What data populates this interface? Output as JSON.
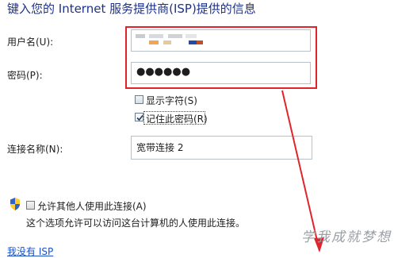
{
  "heading": "键入您的 Internet 服务提供商(ISP)提供的信息",
  "username": {
    "label": "用户名(U):"
  },
  "password": {
    "label": "密码(P):",
    "value": "●●●●●●"
  },
  "show_chars": {
    "label": "显示字符(S)",
    "checked": false
  },
  "remember_password": {
    "label": "记住此密码(R)",
    "checked": true
  },
  "connection_name": {
    "label": "连接名称(N):",
    "value": "宽带连接 2"
  },
  "allow_others": {
    "label": "允许其他人使用此连接(A)",
    "description": "这个选项允许可以访问这台计算机的人使用此连接。",
    "checked": false
  },
  "no_isp_link": "我没有 ISP",
  "watermark": "学我成就梦想",
  "colors": {
    "heading": "#1e3287",
    "link": "#1a50c8",
    "annotation": "#e0242c"
  },
  "icons": {
    "uac_shield": "shield-icon"
  }
}
